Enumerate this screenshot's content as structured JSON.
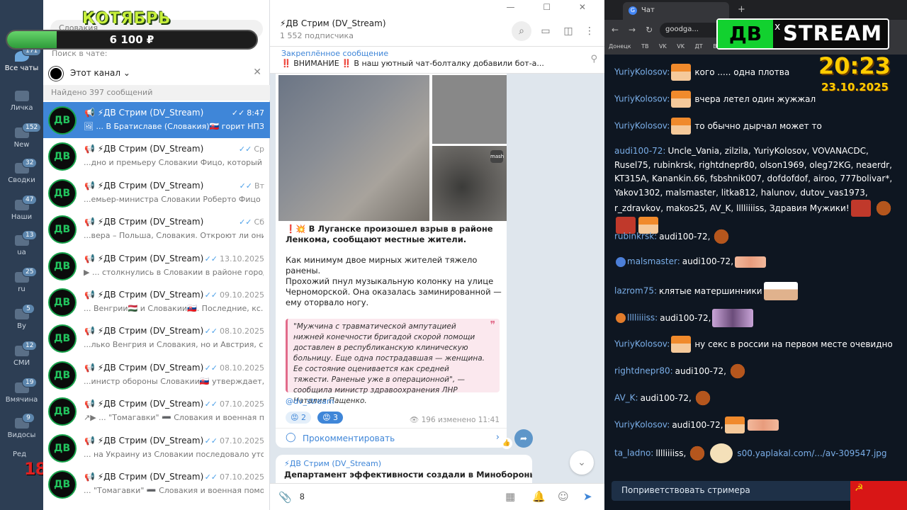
{
  "overlay": {
    "month": "КОТЯБРЬ",
    "amount": "6 100 ₽",
    "progress": 0.2,
    "age": "18+"
  },
  "folders": [
    {
      "label": "Все чаты",
      "badge": "171"
    },
    {
      "label": "Личка",
      "badge": ""
    },
    {
      "label": "New",
      "badge": "152"
    },
    {
      "label": "Сводки",
      "badge": "32"
    },
    {
      "label": "Наши",
      "badge": "47"
    },
    {
      "label": "ua",
      "badge": "13"
    },
    {
      "label": "ru",
      "badge": "25"
    },
    {
      "label": "By",
      "badge": "5"
    },
    {
      "label": "СМИ",
      "badge": "12"
    },
    {
      "label": "Вмячина",
      "badge": "19"
    },
    {
      "label": "Видосы",
      "badge": "9"
    }
  ],
  "edit_label": "Ред",
  "search": {
    "value": "Словакия",
    "in_chat": "Поиск в чате:",
    "scope": "Этот канал",
    "found": "Найдено 397 сообщений"
  },
  "rows": [
    {
      "name": "📢 ⚡ДВ Стрим (DV_Stream)",
      "time": "8:47",
      "preview": "🖼 ... В Братиславе (Словакия)🇸🇰 горит НПЗ, ко..."
    },
    {
      "name": "📢 ⚡ДВ Стрим (DV_Stream)",
      "time": "Ср",
      "preview": "...дно и премьеру Словакии Фицо, который ..."
    },
    {
      "name": "📢 ⚡ДВ Стрим (DV_Stream)",
      "time": "Вт",
      "preview": "...емьер-министра Словакии Роберто Фицо (в р..."
    },
    {
      "name": "📢 ⚡ДВ Стрим (DV_Stream)",
      "time": "Сб",
      "preview": "...вера – Польша, Словакия. Откроют ли они..."
    },
    {
      "name": "📢 ⚡ДВ Стрим (DV_Stream)",
      "time": "13.10.2025",
      "preview": "▶ ... столкнулись в Словакии в районе города ..."
    },
    {
      "name": "📢 ⚡ДВ Стрим (DV_Stream)",
      "time": "09.10.2025",
      "preview": "... Венгрии🇭🇺 и Словакии🇸🇰. Последние, кс..."
    },
    {
      "name": "📢 ⚡ДВ Стрим (DV_Stream)",
      "time": "08.10.2025",
      "preview": "...лько Венгрия и Словакия, но и Австрия, сооб..."
    },
    {
      "name": "📢 ⚡ДВ Стрим (DV_Stream)",
      "time": "08.10.2025",
      "preview": "...инистр обороны Словакии🇸🇰 утверждает,..."
    },
    {
      "name": "📢 ⚡ДВ Стрим (DV_Stream)",
      "time": "07.10.2025",
      "preview": "↗▶ ... \"Томагавки\" ➖ Словакия и военная по..."
    },
    {
      "name": "📢 ⚡ДВ Стрим (DV_Stream)",
      "time": "07.10.2025",
      "preview": "... на Украину из Словакии последовало уточне..."
    },
    {
      "name": "📢 ⚡ДВ Стрим (DV_Stream)",
      "time": "07.10.2025",
      "preview": "... \"Томагавки\" ➖ Словакия и военная помо..."
    }
  ],
  "channel": {
    "title": "⚡ДВ Стрим (DV_Stream)",
    "subs": "1 552 подписчика",
    "win": "— ☐ ✕"
  },
  "pinned": {
    "title": "Закреплённое сообщение",
    "text": "‼️ ВНИМАНИЕ ‼️ В наш уютный чат-болталку добавили бот-а..."
  },
  "message": {
    "title": "❗💥 В Луганске произошел взрыв в районе Ленкома, сообщают местные жители.",
    "p1": "Как минимум двое мирных жителей тяжело ранены.",
    "p2": "Прохожий пнул музыкальную колонку на улице Черноморской. Она оказалась заминированной — ему оторвало ногу.",
    "quote": "\"Мужчина с травматической ампутацией нижней конечности бригадой скорой помощи доставлен в республиканскую клиническую больницу. Еще одна пострадавшая — женщина. Ее состояние оценивается как средней тяжести. Раненые уже в операционной\", — сообщила министр здравоохранения ЛНР Наталия Пащенко.",
    "handle": "@dv_stream",
    "r1": "😡 2",
    "r2": "😡 3",
    "meta": "👁 196  изменено 11:41",
    "comment": "Прокомментировать",
    "mash": "mash"
  },
  "message2": {
    "from": "⚡ДВ Стрим (DV_Stream)",
    "text": "Департамент эффективности создали в Минобороны РФ — он"
  },
  "composer": {
    "value": "8"
  },
  "browser": {
    "tab": "Чат",
    "url": "goodga...",
    "bookmarks": "Донецк  ТВ  VK  VK  ДТ  ВК  ЛТ  ...",
    "logo_a": "ДВ",
    "logo_b": "STREAM",
    "time": "20:23",
    "date": "23.10.2025"
  },
  "chat": [
    {
      "user": "YuriyKolosov:",
      "pre": "fry",
      "text": "кого ..... одна плотва",
      "post": ""
    },
    {
      "user": "YuriyKolosov:",
      "pre": "fry",
      "text": "вчера летел один жужжал",
      "post": ""
    },
    {
      "user": "YuriyKolosov:",
      "pre": "fry",
      "text": "то обычно дырчал может то",
      "post": ""
    },
    {
      "user": "audi100-72:",
      "pre": "",
      "text": "Uncle_Vania, zilzila, YuriyKolosov, VOVANACDC, Rusel75, rubinkrsk, rightdnepr80, olson1969, oleg72KG, neaerdr, KT315A, Kanankin.66, fsbshnik007, dofdofdof, airoo, 777bolivar*, Yakov1302, malsmaster, litka812, halunov, dutov_vas1973, r_zdravkov, makos25, AV_K, lllliiiiss, Здравия Мужики!",
      "post": "grp"
    },
    {
      "user": "rubinkrsk:",
      "pre": "",
      "text": "audi100-72,",
      "post": "beaver"
    },
    {
      "user": "malsmaster:",
      "pre": "eagle",
      "text": "audi100-72,",
      "post": "hands"
    },
    {
      "user": "lazrom75:",
      "pre": "",
      "text": "клятые матершинники",
      "post": "man"
    },
    {
      "user": "lllliiiiss:",
      "pre": "owl",
      "text": "audi100-72,",
      "post": "cat"
    },
    {
      "user": "YuriyKolosov:",
      "pre": "fry",
      "text": "ну секс в россии на первом месте очевидно",
      "post": ""
    },
    {
      "user": "rightdnepr80:",
      "pre": "",
      "text": "audi100-72,",
      "post": "beaver"
    },
    {
      "user": "AV_K:",
      "pre": "",
      "text": "audi100-72,",
      "post": "beaver"
    },
    {
      "user": "YuriyKolosov:",
      "pre": "",
      "text": "audi100-72,",
      "post": "fryhands"
    },
    {
      "user": "ta_ladno:",
      "pre": "",
      "text": "lllliiiiss,",
      "post": "beaverseal"
    }
  ],
  "link": "s00.yaplakal.com/.../av-309547.jpg",
  "greet": "Поприветствовать стримера"
}
